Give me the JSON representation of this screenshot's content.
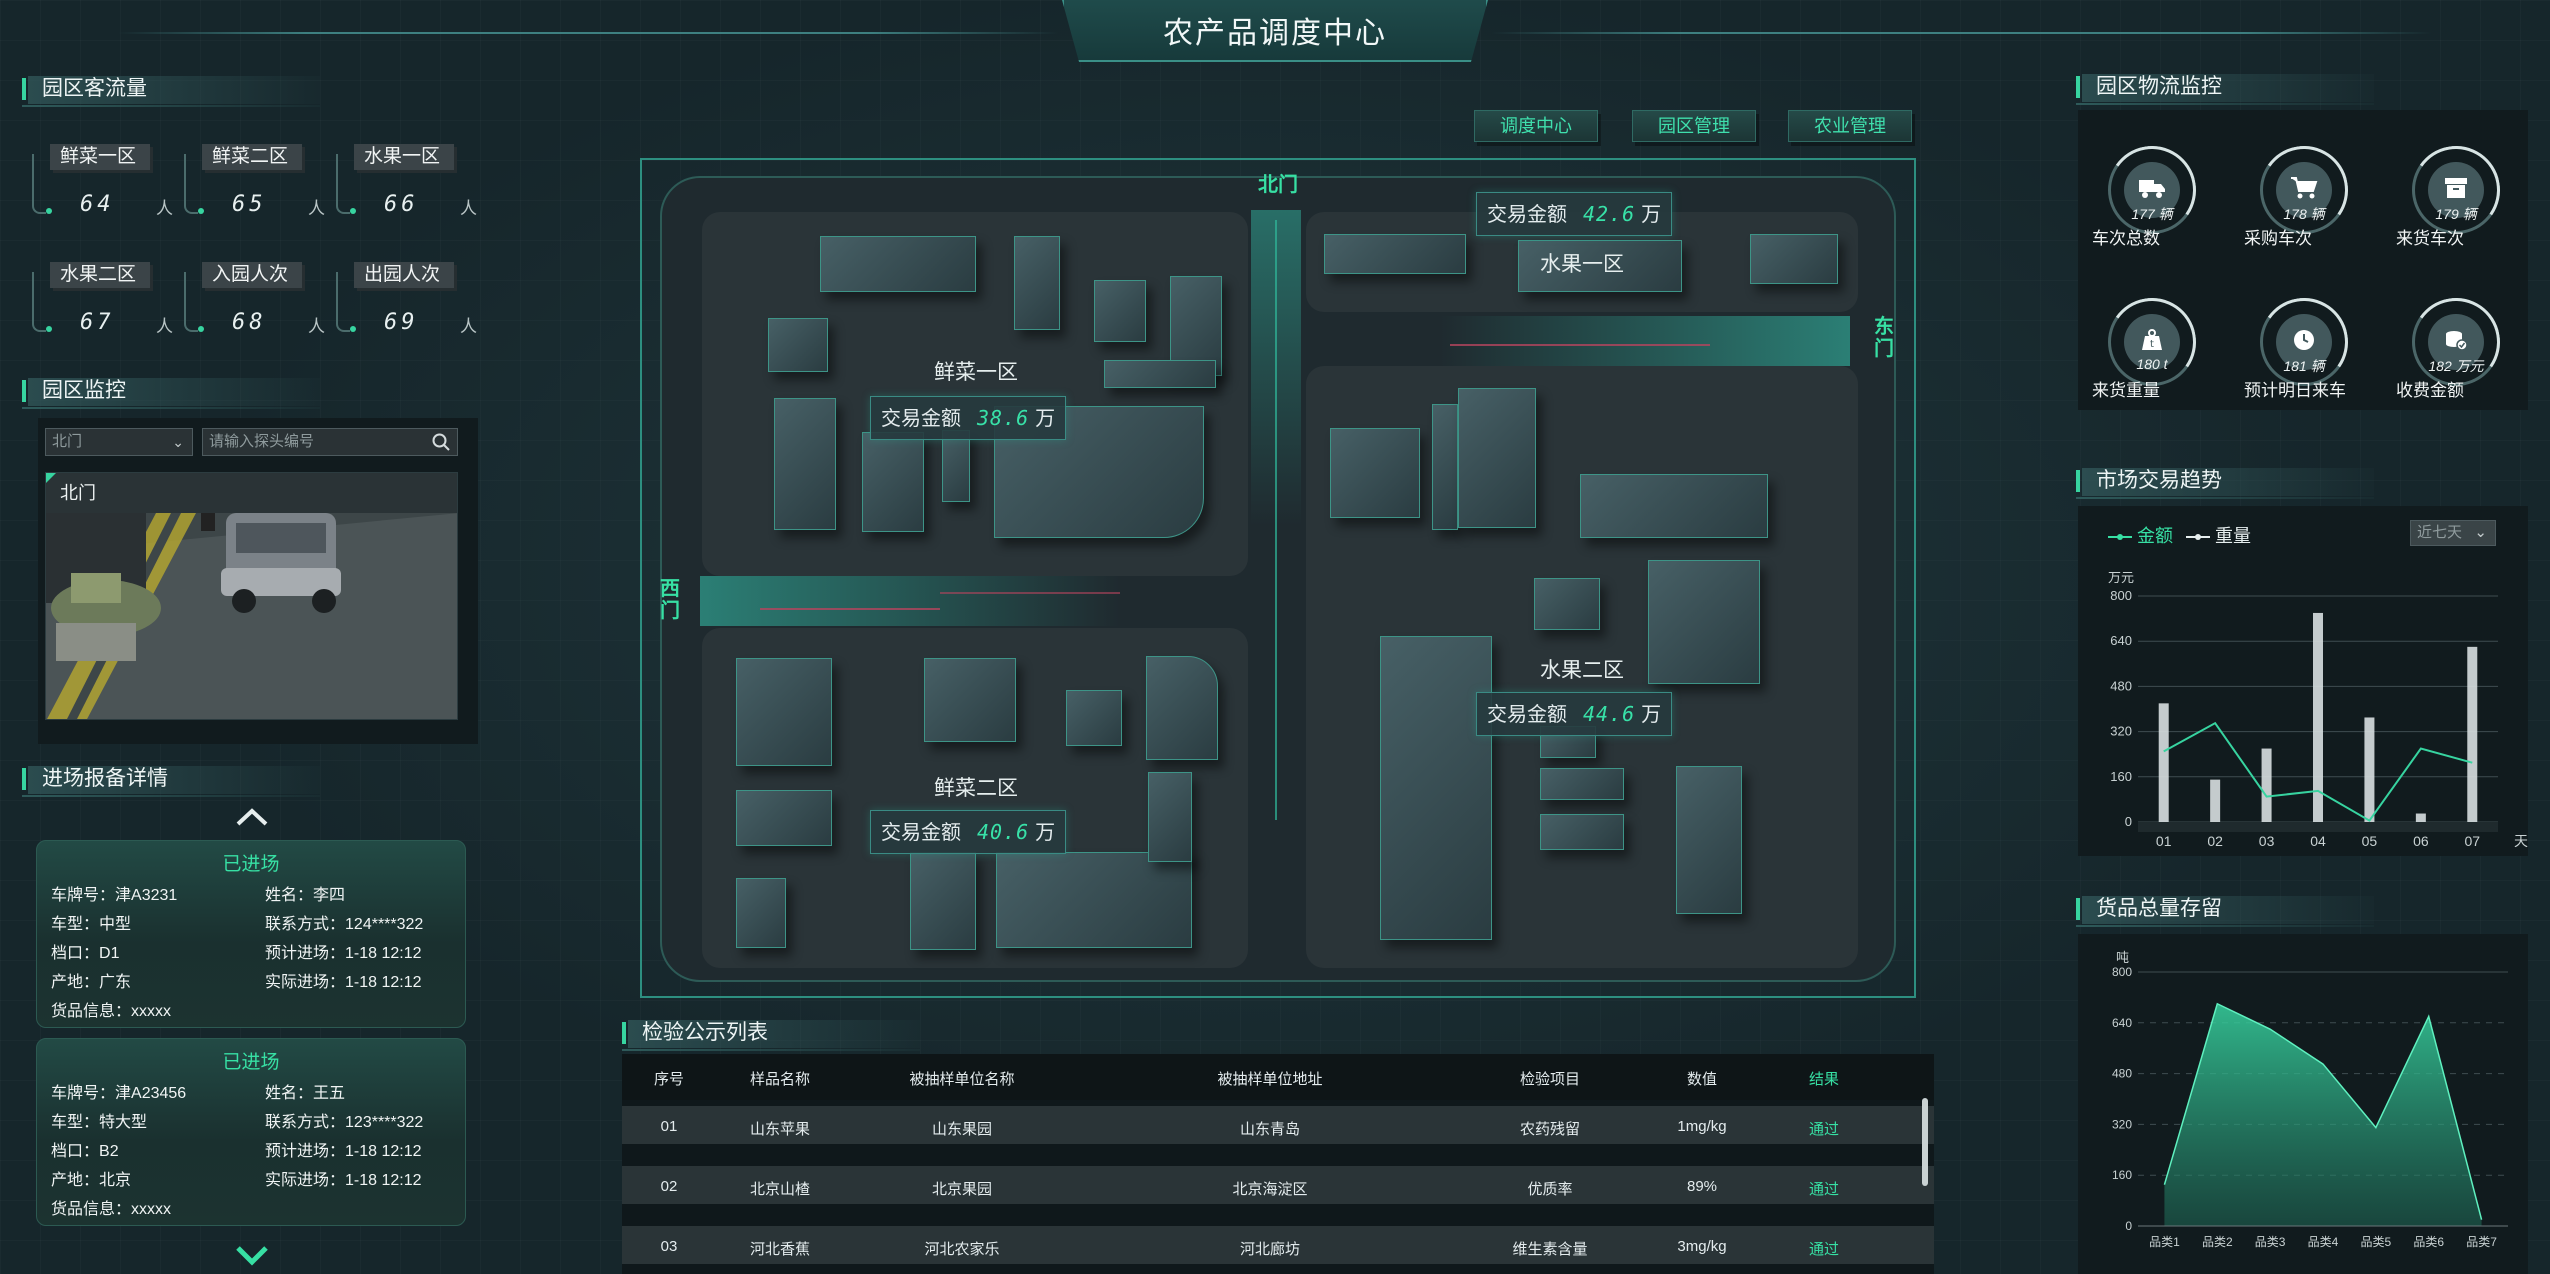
{
  "header": {
    "title": "农产品调度中心"
  },
  "nav": [
    {
      "label": "调度中心"
    },
    {
      "label": "园区管理"
    },
    {
      "label": "农业管理"
    }
  ],
  "visitors": {
    "title": "园区客流量",
    "items": [
      {
        "label": "鲜菜一区",
        "value": "64",
        "unit": "人"
      },
      {
        "label": "鲜菜二区",
        "value": "65",
        "unit": "人"
      },
      {
        "label": "水果一区",
        "value": "66",
        "unit": "人"
      },
      {
        "label": "水果二区",
        "value": "67",
        "unit": "人"
      },
      {
        "label": "入园人次",
        "value": "68",
        "unit": "人"
      },
      {
        "label": "出园人次",
        "value": "69",
        "unit": "人"
      }
    ]
  },
  "monitor": {
    "title": "园区监控",
    "gate_select": "北门",
    "search_placeholder": "请输入探头编号",
    "camera_label": "北门"
  },
  "reports": {
    "title": "进场报备详情",
    "cards": [
      {
        "status": "已进场",
        "plate_label": "车牌号：",
        "plate": "津A3231",
        "name_label": "姓名：",
        "name": "李四",
        "type_label": "车型：",
        "type": "中型",
        "phone_label": "联系方式：",
        "phone": "124****322",
        "stall_label": "档口：",
        "stall": "D1",
        "expected_label": "预计进场：",
        "expected": "1-18 12:12",
        "origin_label": "产地：",
        "origin": "广东",
        "actual_label": "实际进场：",
        "actual": "1-18 12:12",
        "goods_label": "货品信息：",
        "goods": "xxxxx"
      },
      {
        "status": "已进场",
        "plate_label": "车牌号：",
        "plate": "津A23456",
        "name_label": "姓名：",
        "name": "王五",
        "type_label": "车型：",
        "type": "特大型",
        "phone_label": "联系方式：",
        "phone": "123****322",
        "stall_label": "档口：",
        "stall": "B2",
        "expected_label": "预计进场：",
        "expected": "1-18 12:12",
        "origin_label": "产地：",
        "origin": "北京",
        "actual_label": "实际进场：",
        "actual": "1-18 12:12",
        "goods_label": "货品信息：",
        "goods": "xxxxx"
      }
    ]
  },
  "map": {
    "gates": {
      "north": "北门",
      "east": "东门",
      "west": "西门"
    },
    "areas": [
      {
        "name": "鲜菜一区",
        "amount_label": "交易金额",
        "amount": "38.6",
        "unit": "万"
      },
      {
        "name": "水果一区",
        "amount_label": "交易金额",
        "amount": "42.6",
        "unit": "万"
      },
      {
        "name": "鲜菜二区",
        "amount_label": "交易金额",
        "amount": "40.6",
        "unit": "万"
      },
      {
        "name": "水果二区",
        "amount_label": "交易金额",
        "amount": "44.6",
        "unit": "万"
      }
    ]
  },
  "inspection": {
    "title": "检验公示列表",
    "columns": [
      "序号",
      "样品名称",
      "被抽样单位名称",
      "被抽样单位地址",
      "检验项目",
      "数值",
      "结果"
    ],
    "rows": [
      [
        "01",
        "山东苹果",
        "山东果园",
        "山东青岛",
        "农药残留",
        "1mg/kg",
        "通过"
      ],
      [
        "02",
        "北京山楂",
        "北京果园",
        "北京海淀区",
        "优质率",
        "89%",
        "通过"
      ],
      [
        "03",
        "河北香蕉",
        "河北农家乐",
        "河北廊坊",
        "维生素含量",
        "3mg/kg",
        "通过"
      ]
    ]
  },
  "logistics": {
    "title": "园区物流监控",
    "items": [
      {
        "label": "车次总数",
        "value": "177",
        "unit": "辆",
        "icon": "truck-icon"
      },
      {
        "label": "采购车次",
        "value": "178",
        "unit": "辆",
        "icon": "cart-icon"
      },
      {
        "label": "来货车次",
        "value": "179",
        "unit": "辆",
        "icon": "box-icon"
      },
      {
        "label": "来货重量",
        "value": "180",
        "unit": "t",
        "icon": "weight-icon"
      },
      {
        "label": "预计明日来车",
        "value": "181",
        "unit": "辆",
        "icon": "clock-icon"
      },
      {
        "label": "收费金额",
        "value": "182",
        "unit": "万元",
        "icon": "coins-icon"
      }
    ]
  },
  "trend": {
    "title": "市场交易趋势",
    "legend_amount": "金额",
    "legend_weight": "重量",
    "range_select": "近七天"
  },
  "storage": {
    "title": "货品总量存留"
  },
  "colors": {
    "accent": "#37d4a0",
    "bg": "#16262b",
    "panel": "#111b1e"
  },
  "chart_data": [
    {
      "type": "bar",
      "ylabel": "万元",
      "xlabel": "天",
      "categories": [
        "01",
        "02",
        "03",
        "04",
        "05",
        "06",
        "07"
      ],
      "ylim": [
        0,
        800
      ],
      "yticks": [
        0,
        160,
        320,
        480,
        640,
        800
      ],
      "series": [
        {
          "name": "重量",
          "type": "bar",
          "values": [
            420,
            150,
            260,
            740,
            370,
            30,
            620
          ]
        },
        {
          "name": "金额",
          "type": "line",
          "values": [
            250,
            350,
            90,
            110,
            5,
            260,
            210
          ]
        }
      ]
    },
    {
      "type": "area",
      "ylabel": "吨",
      "categories": [
        "品类1",
        "品类2",
        "品类3",
        "品类4",
        "品类5",
        "品类6",
        "品类7"
      ],
      "ylim": [
        0,
        800
      ],
      "yticks": [
        0,
        160,
        320,
        480,
        640,
        800
      ],
      "values": [
        130,
        700,
        620,
        510,
        310,
        660,
        20
      ]
    }
  ]
}
